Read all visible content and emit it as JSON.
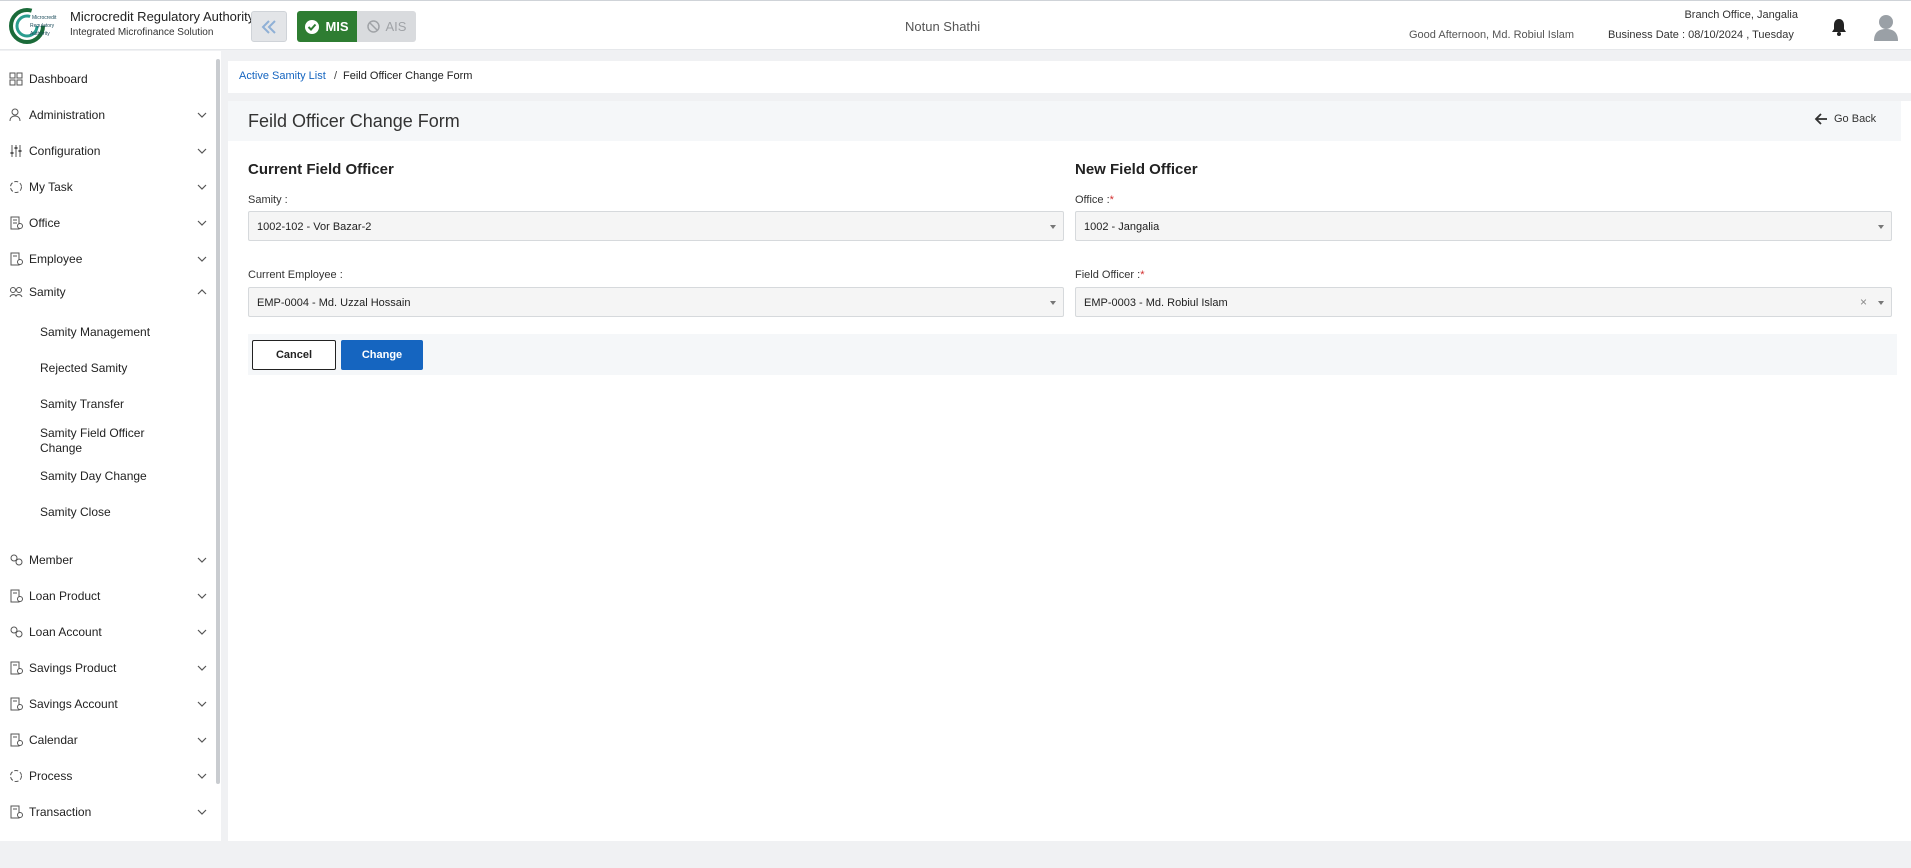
{
  "header": {
    "org_title": "Microcredit Regulatory Authority",
    "org_subtitle": "Integrated Microfinance Solution",
    "logo_text": "Microcredit Regulatory Authority",
    "mis_label": "MIS",
    "ais_label": "AIS",
    "center_name": "Notun Shathi",
    "branch_office": "Branch Office, Jangalia",
    "greeting": "Good Afternoon, Md. Robiul Islam",
    "business_date": "Business Date : 08/10/2024 , Tuesday",
    "accent_color": "#2e7d32"
  },
  "sidebar": {
    "items": [
      {
        "label": "Dashboard",
        "icon": "dashboard-icon"
      },
      {
        "label": "Administration",
        "icon": "admin-icon"
      },
      {
        "label": "Configuration",
        "icon": "sliders-icon"
      },
      {
        "label": "My Task",
        "icon": "task-icon"
      },
      {
        "label": "Office",
        "icon": "office-icon"
      },
      {
        "label": "Employee",
        "icon": "employee-icon"
      },
      {
        "label": "Samity",
        "icon": "samity-icon"
      },
      {
        "label": "Member",
        "icon": "member-icon"
      },
      {
        "label": "Loan Product",
        "icon": "loan-product-icon"
      },
      {
        "label": "Loan Account",
        "icon": "loan-account-icon"
      },
      {
        "label": "Savings Product",
        "icon": "savings-product-icon"
      },
      {
        "label": "Savings Account",
        "icon": "savings-account-icon"
      },
      {
        "label": "Calendar",
        "icon": "calendar-icon"
      },
      {
        "label": "Process",
        "icon": "process-icon"
      },
      {
        "label": "Transaction",
        "icon": "transaction-icon"
      }
    ],
    "samity_sub": [
      "Samity Management",
      "Rejected Samity",
      "Samity Transfer",
      "Samity Field Officer Change",
      "Samity Day Change",
      "Samity Close"
    ]
  },
  "breadcrumb": {
    "link": "Active Samity List",
    "separator": "/",
    "current": "Feild Officer Change Form"
  },
  "form": {
    "title": "Feild Officer Change Form",
    "go_back": "Go Back",
    "current_section": "Current Field Officer",
    "new_section": "New Field Officer",
    "samity_label": "Samity :",
    "samity_value": "1002-102 - Vor Bazar-2",
    "current_employee_label": "Current Employee :",
    "current_employee_value": "EMP-0004 - Md. Uzzal Hossain",
    "office_label": "Office :",
    "office_value": "1002 - Jangalia",
    "field_officer_label": "Field Officer :",
    "field_officer_value": "EMP-0003 - Md. Robiul Islam",
    "required_mark": "*",
    "clear_mark": "×",
    "cancel_label": "Cancel",
    "change_label": "Change"
  }
}
